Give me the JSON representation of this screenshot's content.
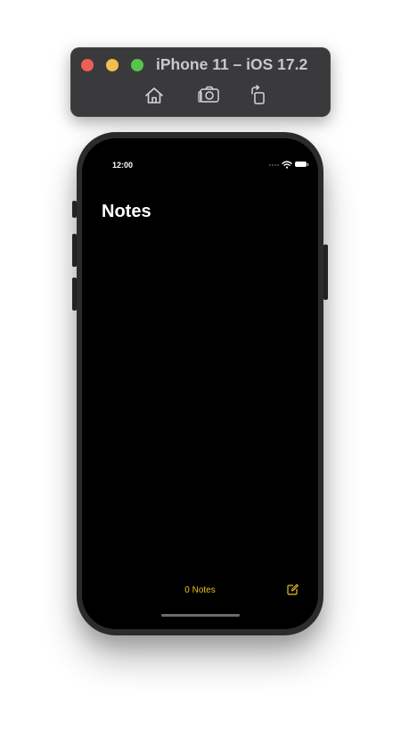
{
  "window": {
    "title": "iPhone 11 – iOS 17.2"
  },
  "toolbar": {
    "icons": [
      "home-icon",
      "screenshot-icon",
      "rotate-icon"
    ]
  },
  "status_bar": {
    "time": "12:00"
  },
  "app": {
    "title": "Notes",
    "notes_count": "0 Notes",
    "accent_color": "#e8c21b"
  }
}
